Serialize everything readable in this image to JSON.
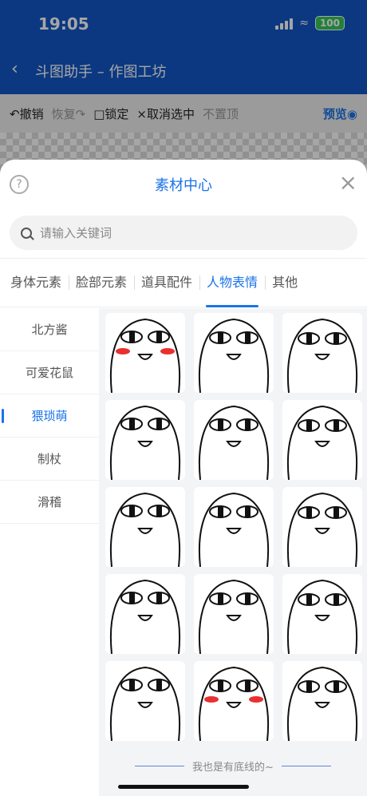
{
  "status_bar": {
    "time": "19:05",
    "battery": "100"
  },
  "app_header": {
    "title": "斗图助手 – 作图工坊"
  },
  "toolbar": {
    "undo": "撤销",
    "redo": "恢复",
    "lock": "锁定",
    "deselect": "取消选中",
    "pin_top": "不置顶",
    "preview": "预览"
  },
  "sheet": {
    "title": "素材中心",
    "search_placeholder": "请输入关键词",
    "footer": "我也是有底线的~"
  },
  "tabs": [
    {
      "label": "身体元素",
      "active": false
    },
    {
      "label": "脸部元素",
      "active": false
    },
    {
      "label": "道具配件",
      "active": false
    },
    {
      "label": "人物表情",
      "active": true
    },
    {
      "label": "其他",
      "active": false
    }
  ],
  "categories": [
    {
      "label": "北方酱",
      "active": false
    },
    {
      "label": "可爱花鼠",
      "active": false
    },
    {
      "label": "猥琐萌",
      "active": true
    },
    {
      "label": "制杖",
      "active": false
    },
    {
      "label": "滑稽",
      "active": false
    }
  ],
  "colors": {
    "accent": "#1a73e8",
    "header": "#1257c6",
    "battery": "#34c759"
  },
  "stickers": [
    {
      "name": "blush-hand-sticker",
      "blush": true
    },
    {
      "name": "peace-sign-sticker"
    },
    {
      "name": "angry-shake-sticker"
    },
    {
      "name": "smirk-sticker"
    },
    {
      "name": "spread-arms-sticker"
    },
    {
      "name": "shy-thinking-sticker"
    },
    {
      "name": "singing-sticker"
    },
    {
      "name": "derp-eyes-sticker"
    },
    {
      "name": "smile-sticker"
    },
    {
      "name": "sheepish-sticker"
    },
    {
      "name": "crying-sticker"
    },
    {
      "name": "annoyed-sticker"
    },
    {
      "name": "smoking-sticker"
    },
    {
      "name": "red-cheeks-sticker",
      "blush": true
    },
    {
      "name": "thumbs-up-sticker"
    }
  ]
}
